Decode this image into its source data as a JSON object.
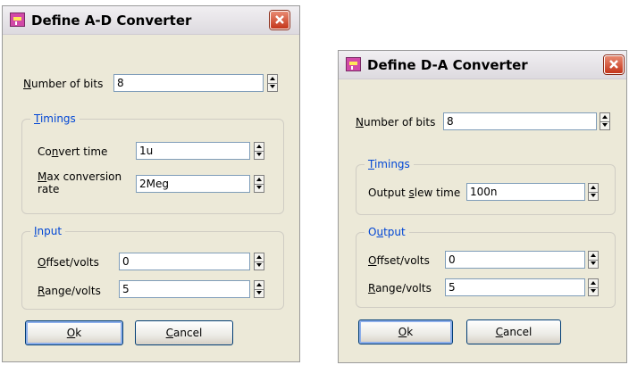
{
  "colors": {
    "dialog_bg": "#ece9d8",
    "group_legend": "#0046d5",
    "close_button": "#c4361b"
  },
  "ad_dialog": {
    "title": "Define A-D Converter",
    "bits": {
      "label_ul": "N",
      "label_rest": "umber of bits",
      "value": "8"
    },
    "timings": {
      "legend_ul": "T",
      "legend_rest": "imings",
      "convert_time": {
        "label_pre": "Co",
        "label_ul": "n",
        "label_post": "vert time",
        "value": "1u"
      },
      "max_conversion_rate": {
        "label_ul": "M",
        "label_line1": "ax conversion",
        "label_line2": "rate",
        "value": "2Meg"
      }
    },
    "input": {
      "legend_ul": "I",
      "legend_rest": "nput",
      "offset": {
        "label_ul": "O",
        "label_rest": "ffset/volts",
        "value": "0"
      },
      "range": {
        "label_ul": "R",
        "label_rest": "ange/volts",
        "value": "5"
      }
    },
    "ok_ul": "O",
    "ok_rest": "k",
    "cancel_ul": "C",
    "cancel_rest": "ancel"
  },
  "da_dialog": {
    "title": "Define D-A Converter",
    "bits": {
      "label_ul": "N",
      "label_rest": "umber of bits",
      "value": "8"
    },
    "timings": {
      "legend_ul": "T",
      "legend_rest": "imings",
      "output_slew_time": {
        "label_pre": "Output ",
        "label_ul": "s",
        "label_post": "lew time",
        "value": "100n"
      }
    },
    "output": {
      "legend_pre": "O",
      "legend_ul": "u",
      "legend_post": "tput",
      "offset": {
        "label_ul": "O",
        "label_rest": "ffset/volts",
        "value": "0"
      },
      "range": {
        "label_ul": "R",
        "label_rest": "ange/volts",
        "value": "5"
      }
    },
    "ok_ul": "O",
    "ok_rest": "k",
    "cancel_ul": "C",
    "cancel_rest": "ancel"
  }
}
